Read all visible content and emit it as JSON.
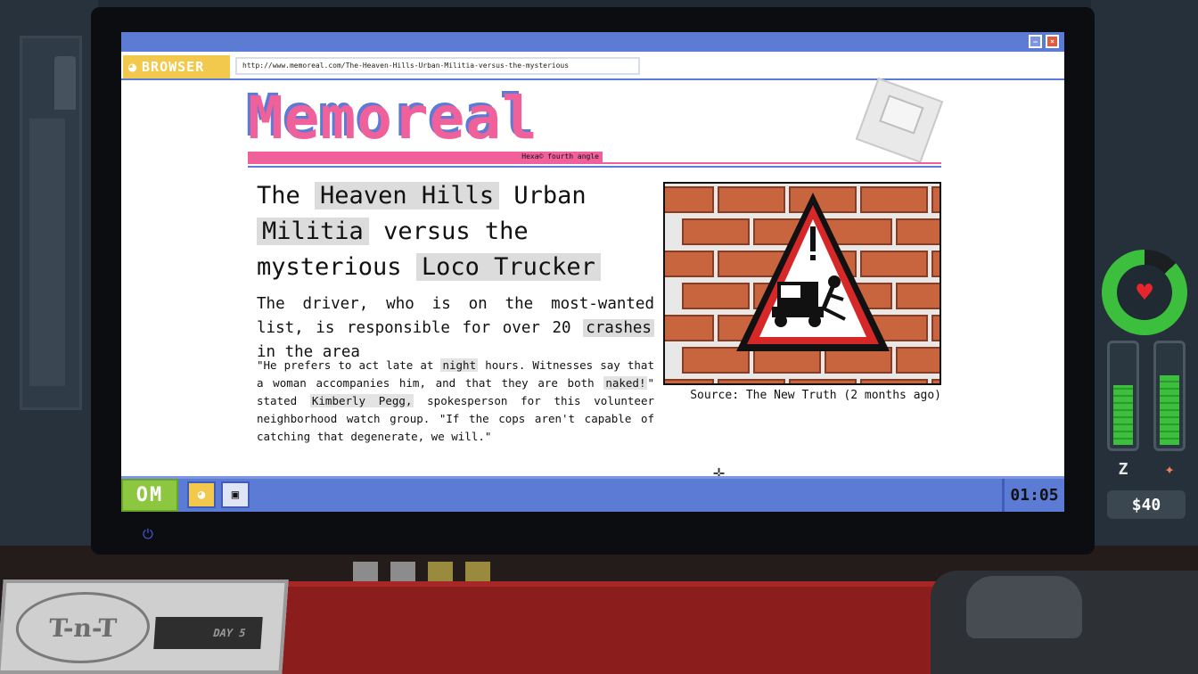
{
  "browser": {
    "tab_label": "BROWSER",
    "url": "http://www.memoreal.com/The-Heaven-Hills-Urban-Militia-versus-the-mysterious"
  },
  "site": {
    "name": "Memoreal",
    "tagline": "Hexa© fourth angle"
  },
  "article": {
    "headline_1": "The",
    "headline_hl1": "Heaven Hills",
    "headline_2": "Urban",
    "headline_hl2": "Militia",
    "headline_3": "versus the mysterious",
    "headline_hl3": "Loco Trucker",
    "sub_1": "The driver, who is on the most-wanted list, is responsible for over 20",
    "sub_hl": "crashes",
    "sub_2": "in the area",
    "body_1": "\"He prefers to act late at",
    "body_hl1": "night",
    "body_2": "hours. Witnesses say that a woman accompanies him, and that they are both",
    "body_hl2": "naked!",
    "body_3": "\" stated",
    "body_hl3": "Kimberly Pegg,",
    "body_4": "spokesperson for this volunteer neighborhood watch group. \"If the cops aren't capable of catching that degenerate, we will.\"",
    "caption": "Source: The New Truth (2 months ago)"
  },
  "taskbar": {
    "start_label": "OM",
    "clock": "01:05"
  },
  "hud": {
    "health_level": 0.87,
    "sleep_level": 0.6,
    "food_level": 0.7,
    "sleep_icon_label": "Z",
    "money": "$40"
  },
  "desk": {
    "notebook_logo": "T-n-T",
    "notebook_day": "DAY 5"
  },
  "colors": {
    "accent_blue": "#5b7bd5",
    "brand_pink": "#f0609a",
    "browser_yellow": "#f2c94c",
    "start_green": "#8dc63f",
    "hud_green": "#3cbf3c"
  }
}
